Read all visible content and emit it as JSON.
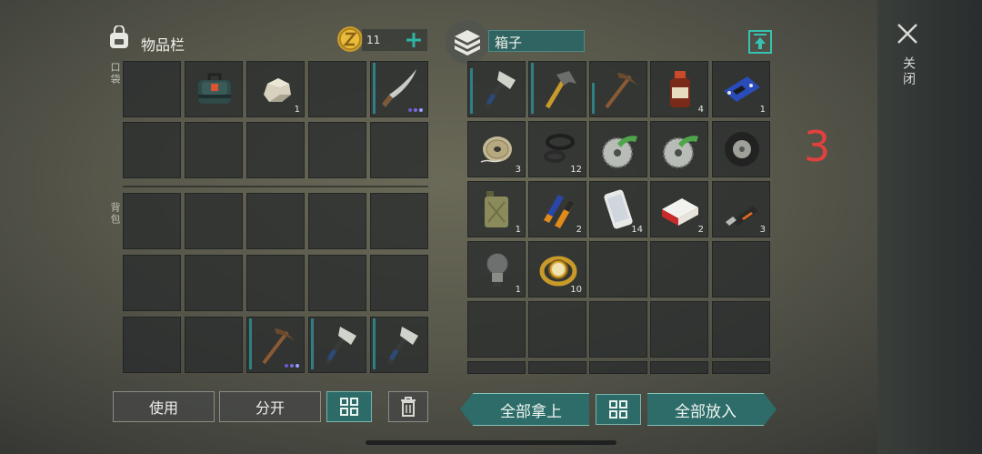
{
  "inventory": {
    "title": "物品栏",
    "coins": "11",
    "pocket_label": "口袋",
    "backpack_label": "背包"
  },
  "box": {
    "title": "箱子",
    "number_marker": "3"
  },
  "close": {
    "label": "关闭"
  },
  "buttons": {
    "use": "使用",
    "split": "分开",
    "take_all": "全部拿上",
    "put_all": "全部放入"
  },
  "pocket_items": [
    {
      "slot": 1,
      "name": "first-aid-kit",
      "count": ""
    },
    {
      "slot": 2,
      "name": "stone",
      "count": "1"
    },
    {
      "slot": 4,
      "name": "machete",
      "count": ""
    }
  ],
  "backpack_items": [
    {
      "slot": 12,
      "name": "pickaxe",
      "count": ""
    },
    {
      "slot": 13,
      "name": "hatchet",
      "count": ""
    },
    {
      "slot": 14,
      "name": "hatchet",
      "count": ""
    }
  ],
  "box_items": [
    {
      "name": "hatchet",
      "count": ""
    },
    {
      "name": "hammer",
      "count": ""
    },
    {
      "name": "pickaxe",
      "count": ""
    },
    {
      "name": "medicine-bottle",
      "count": "4"
    },
    {
      "name": "circuit-board",
      "count": "1"
    },
    {
      "name": "wire-spool",
      "count": "3"
    },
    {
      "name": "rubber-seals",
      "count": "12"
    },
    {
      "name": "saw-blade",
      "count": ""
    },
    {
      "name": "saw-blade",
      "count": ""
    },
    {
      "name": "tire",
      "count": ""
    },
    {
      "name": "jerrycan",
      "count": "1"
    },
    {
      "name": "batteries",
      "count": "2"
    },
    {
      "name": "smartphone",
      "count": "14"
    },
    {
      "name": "cigarette-pack",
      "count": "2"
    },
    {
      "name": "usb-drive",
      "count": "3"
    },
    {
      "name": "light-bulb",
      "count": "1"
    },
    {
      "name": "wristwatch",
      "count": "10"
    }
  ],
  "colors": {
    "teal": "#2d6c69",
    "marker_red": "#e0413d",
    "rarity_dots": [
      "#6a5acd",
      "#6a5acd",
      "#9aa0ff"
    ]
  }
}
